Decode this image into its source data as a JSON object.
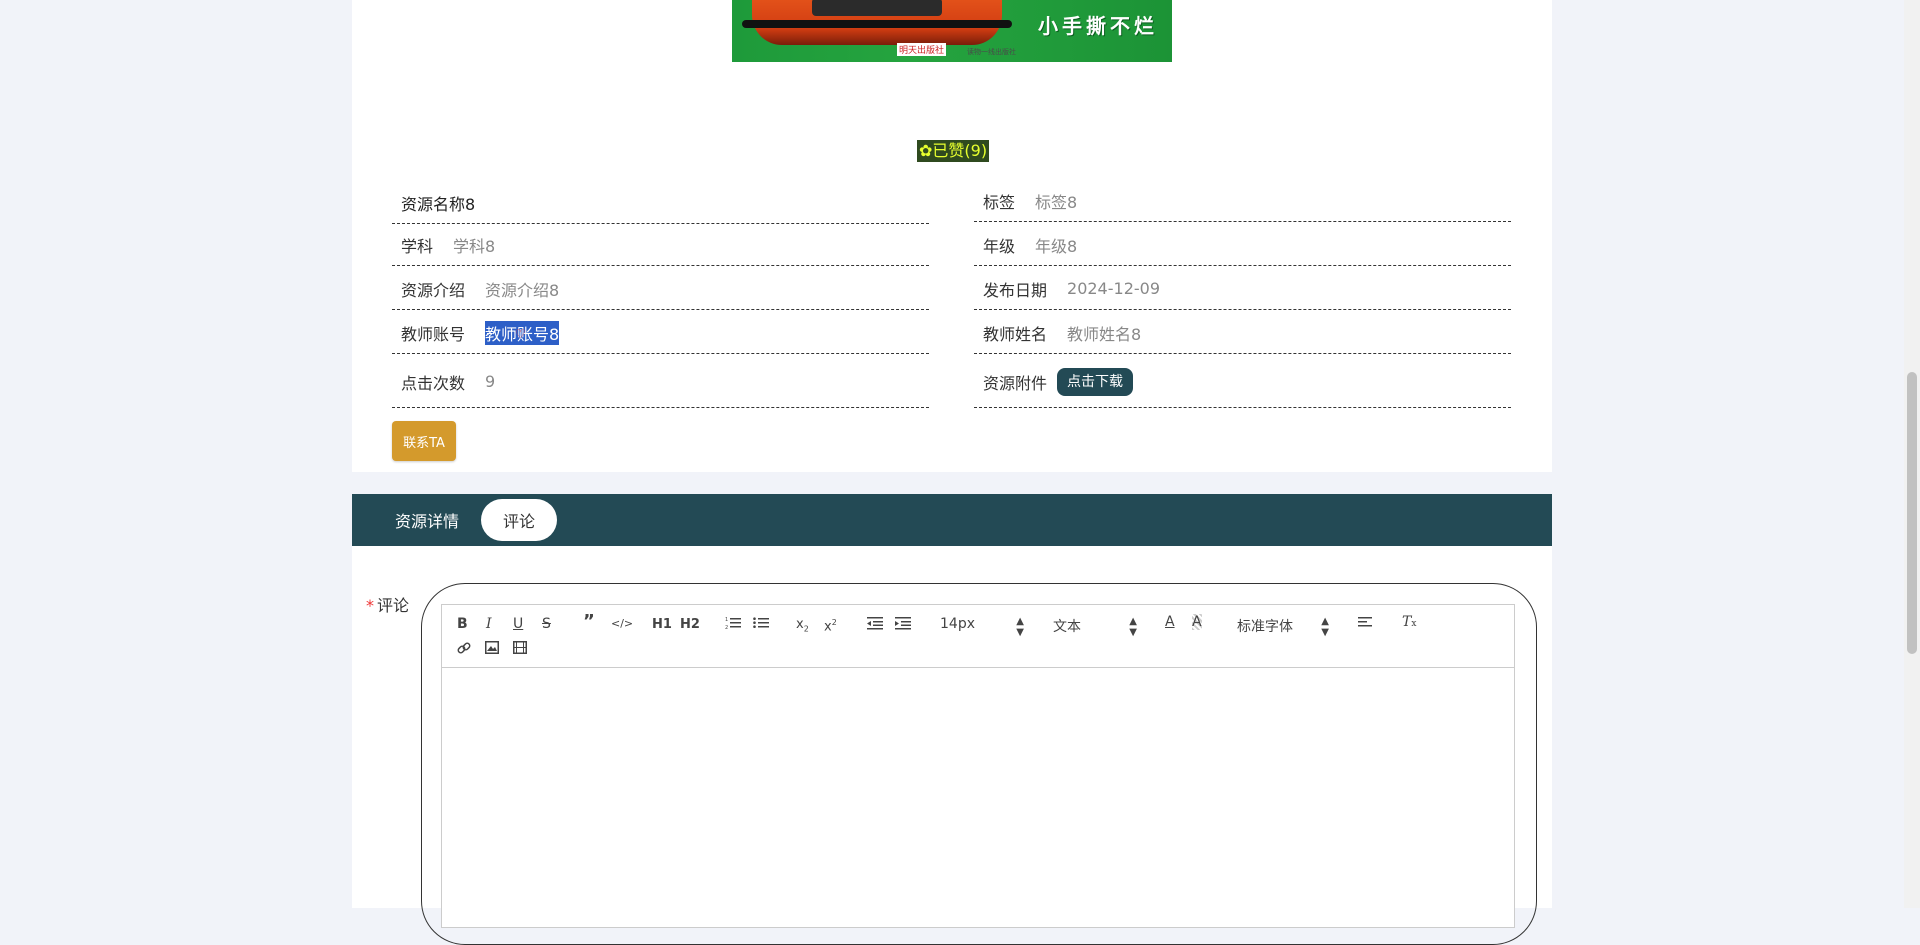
{
  "cover": {
    "slogan": "小手撕不烂",
    "publisher": "明天出版社",
    "publisher_note": "读物一线出版社"
  },
  "like": {
    "label": "已赞(9)",
    "icon": "thumb-icon"
  },
  "details": {
    "name_label": "资源名称8",
    "tag_key": "标签",
    "tag_val": "标签8",
    "subject_key": "学科",
    "subject_val": "学科8",
    "grade_key": "年级",
    "grade_val": "年级8",
    "intro_key": "资源介绍",
    "intro_val": "资源介绍8",
    "date_key": "发布日期",
    "date_val": "2024-12-09",
    "teacher_acc_key": "教师账号",
    "teacher_acc_val": "教师账号8",
    "teacher_name_key": "教师姓名",
    "teacher_name_val": "教师姓名8",
    "clicks_key": "点击次数",
    "clicks_val": "9",
    "attach_key": "资源附件",
    "download_btn": "点击下载"
  },
  "contact_btn": "联系TA",
  "tabs": [
    {
      "label": "资源详情",
      "active": false
    },
    {
      "label": "评论",
      "active": true
    }
  ],
  "comment": {
    "required_mark": "*",
    "label": "评论",
    "toolbar": {
      "font_size": "14px",
      "header_select": "文本",
      "font_family": "标准字体",
      "h1": "H1",
      "h2": "H2",
      "bold": "B",
      "italic": "I",
      "underline": "U",
      "strike": "S"
    }
  },
  "colors": {
    "accent": "#234a55",
    "contact": "#d49a2c",
    "highlight": "#2d5fc7",
    "like_bg": "#2f4a1f",
    "like_fg": "#e6ff2e"
  }
}
